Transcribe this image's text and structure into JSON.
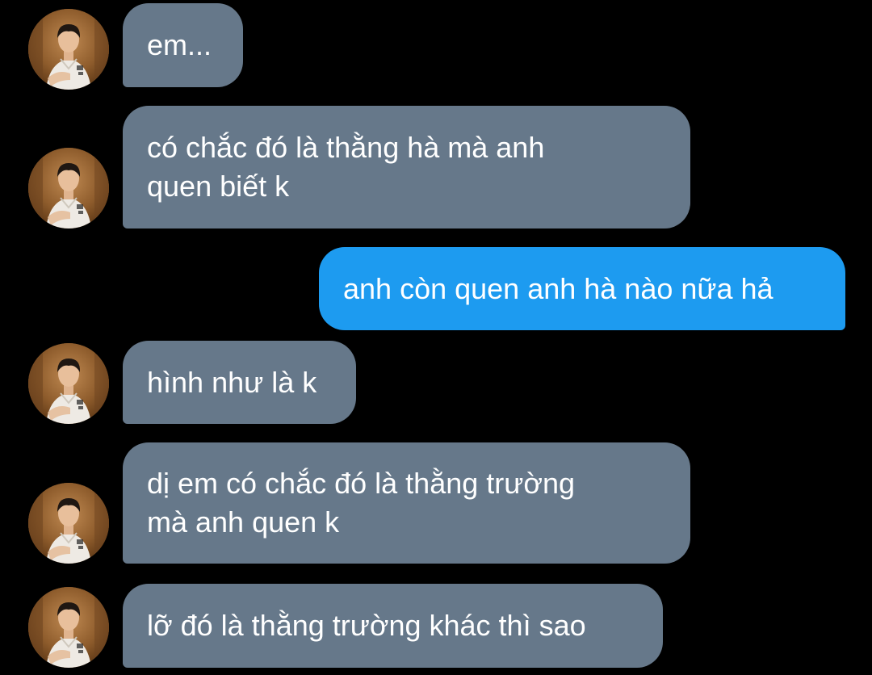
{
  "theme": {
    "background": "#000000",
    "incoming_bubble": "#66788a",
    "outgoing_bubble": "#1d9bf0",
    "text": "#ffffff"
  },
  "contact": {
    "avatar_icon": "profile-photo-avatar"
  },
  "messages": [
    {
      "direction": "incoming",
      "text": "em..."
    },
    {
      "direction": "incoming",
      "text": "có chắc đó là thằng hà mà anh\nquen biết k"
    },
    {
      "direction": "outgoing",
      "text": "anh còn quen anh hà nào nữa hả"
    },
    {
      "direction": "incoming",
      "text": "hình như là k"
    },
    {
      "direction": "incoming",
      "text": "dị em có chắc đó là thằng trường\nmà anh quen k"
    },
    {
      "direction": "incoming",
      "text": "lỡ đó là thằng trường khác thì sao"
    }
  ]
}
